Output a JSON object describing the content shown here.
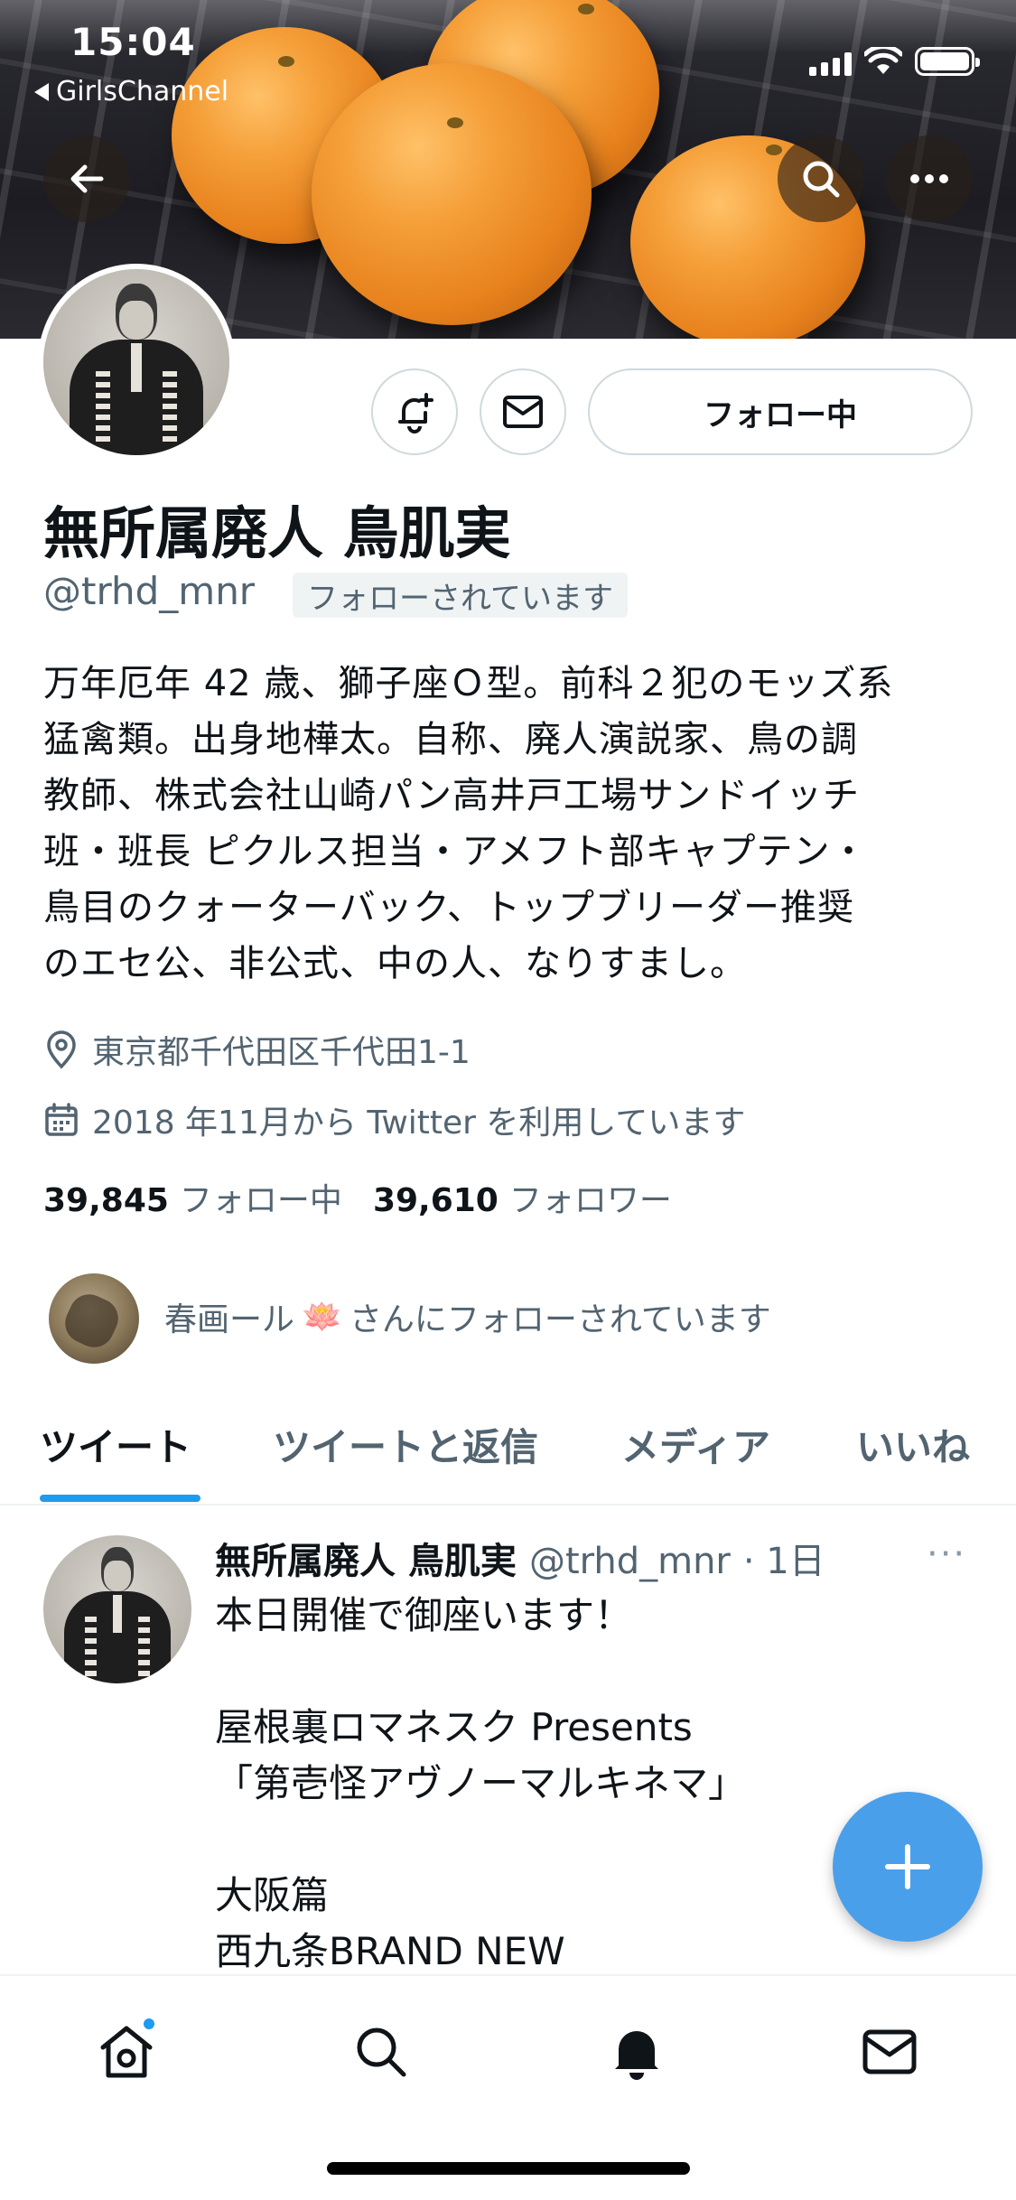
{
  "status_bar": {
    "time": "15:04",
    "back_app": "GirlsChannel"
  },
  "profile": {
    "name": "無所属廃人 鳥肌実",
    "handle": "@trhd_mnr",
    "follows_you_badge": "フォローされています",
    "following_button": "フォロー中",
    "bio": "万年厄年 42 歳、獅子座Ｏ型。前科２犯のモッズ系\n猛禽類。出身地樺太。自称、廃人演説家、鳥の調\n教師、株式会社山崎パン高井戸工場サンドイッチ\n班・班長 ピクルス担当・アメフト部キャプテン・\n鳥目のクォーターバック、トップブリーダー推奨\nのエセ公、非公式、中の人、なりすまし。",
    "location": "東京都千代田区千代田1-1",
    "joined": "2018 年11月から Twitter を利用しています",
    "following_count": "39,845",
    "following_label": "フォロー中",
    "followers_count": "39,610",
    "followers_label": "フォロワー",
    "mutual_prefix": "春画ール",
    "mutual_suffix": "さんにフォローされています"
  },
  "tabs": [
    {
      "label": "ツイート",
      "active": true
    },
    {
      "label": "ツイートと返信",
      "active": false
    },
    {
      "label": "メディア",
      "active": false
    },
    {
      "label": "いいね",
      "active": false
    }
  ],
  "tweet": {
    "author_name": "無所属廃人 鳥肌実",
    "author_handle": "@trhd_mnr",
    "time_ago": "· 1日",
    "more": "···",
    "body": "本日開催で御座います！\n\n屋根裏ロマネスク Presents\n「第壱怪アヴノーマルキネマ」\n\n大阪篇\n西九条BRAND NEW"
  },
  "icons": {
    "back": "back-arrow-icon",
    "search": "search-icon",
    "more": "more-icon",
    "notify": "bell-plus-icon",
    "message": "envelope-icon",
    "location": "location-pin-icon",
    "calendar": "calendar-icon",
    "compose": "plus-icon"
  },
  "colors": {
    "accent": "#1d9bf0",
    "fab": "#4a9fea",
    "secondary_text": "#536471"
  }
}
